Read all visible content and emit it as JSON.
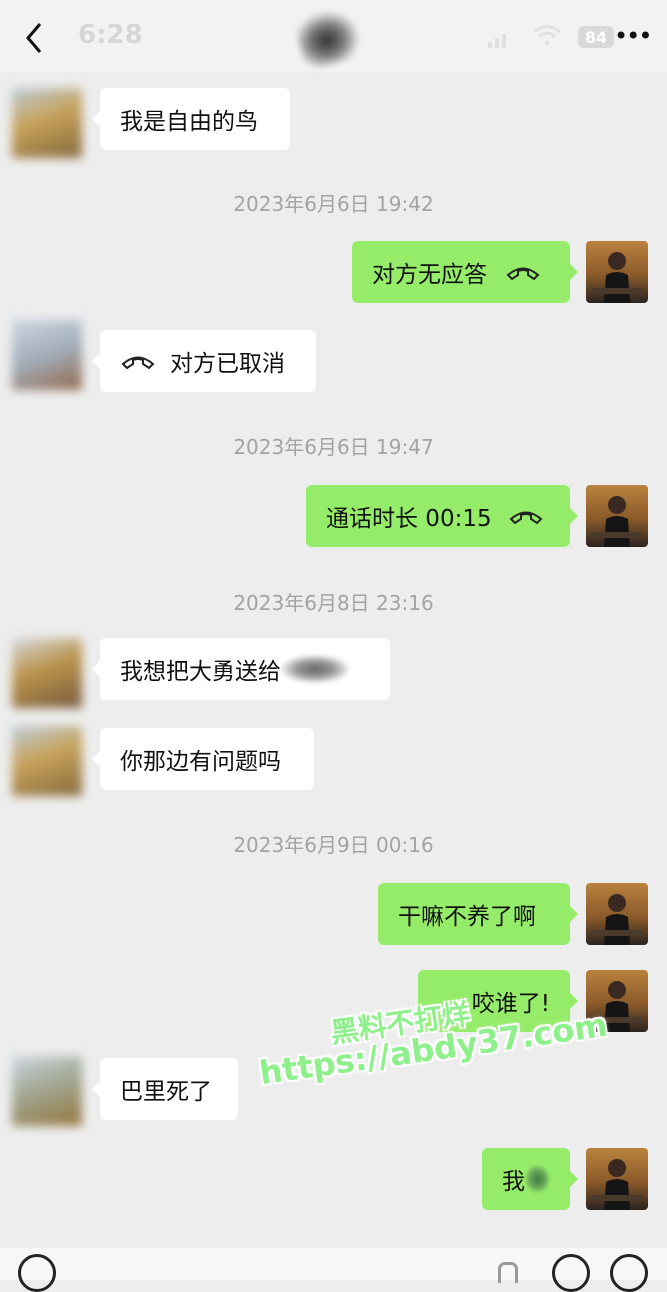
{
  "status": {
    "time": "6:28",
    "battery": "84"
  },
  "colors": {
    "accent_bubble": "#95ec69",
    "background": "#ededed",
    "watermark": "#8ef08a"
  },
  "icons": [
    "back-arrow-icon",
    "signal-icon",
    "wifi-icon",
    "more-icon",
    "phone-hangup-icon",
    "voice-icon",
    "mic-icon",
    "emoji-icon",
    "plus-icon"
  ],
  "messages": {
    "m1": "我是自由的鸟",
    "ts1": "2023年6月6日 19:42",
    "m2": "对方无应答",
    "m3": "对方已取消",
    "ts2": "2023年6月6日 19:47",
    "m4": "通话时长 00:15",
    "ts3": "2023年6月8日 23:16",
    "m5": "我想把大勇送给",
    "m6": "你那边有问题吗",
    "ts4": "2023年6月9日 00:16",
    "m7": "干嘛不养了啊",
    "m8": "咬谁了!",
    "m9": "巴里死了",
    "m10": "我"
  },
  "watermark": {
    "line1": "黑料不打烊",
    "line2": "https://abdy37.com"
  }
}
